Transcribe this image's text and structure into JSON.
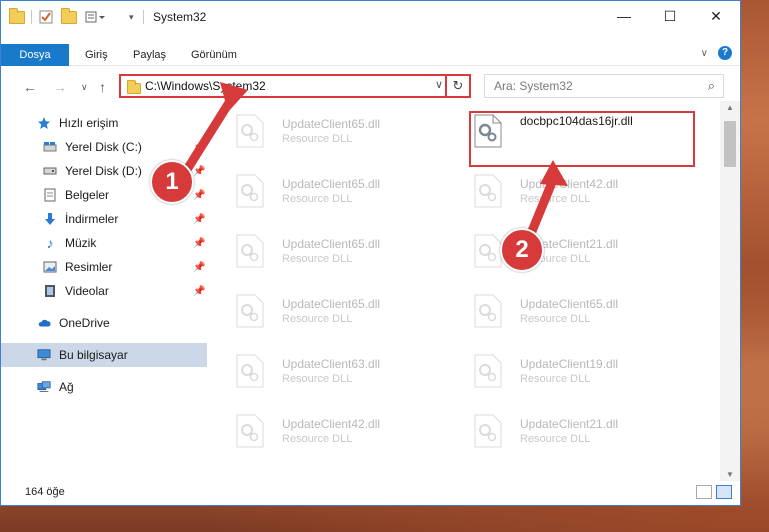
{
  "window": {
    "title": "System32"
  },
  "ribbon": {
    "tabs": [
      "Dosya",
      "Giriş",
      "Paylaş",
      "Görünüm"
    ]
  },
  "address": {
    "path": "C:\\Windows\\System32"
  },
  "search": {
    "placeholder": "Ara: System32"
  },
  "nav": {
    "quick_access": "Hızlı erişim",
    "items": [
      "Yerel Disk (C:)",
      "Yerel Disk (D:)",
      "Belgeler",
      "İndirmeler",
      "Müzik",
      "Resimler",
      "Videolar"
    ],
    "onedrive": "OneDrive",
    "this_pc": "Bu bilgisayar",
    "network": "Ağ"
  },
  "files": {
    "highlighted": {
      "name": "docbpc104das16jr.dll"
    },
    "left_column": [
      {
        "name": "UpdateClient65.dll",
        "desc": "Resource DLL"
      },
      {
        "name": "UpdateClient65.dll",
        "desc": "Resource DLL"
      },
      {
        "name": "UpdateClient65.dll",
        "desc": "Resource DLL"
      },
      {
        "name": "UpdateClient65.dll",
        "desc": "Resource DLL"
      },
      {
        "name": "UpdateClient63.dll",
        "desc": "Resource DLL"
      },
      {
        "name": "UpdateClient42.dll",
        "desc": "Resource DLL"
      }
    ],
    "right_column": [
      {
        "name": "UpdateClient42.dll",
        "desc": "Resource DLL"
      },
      {
        "name": "UpdateClient21.dll",
        "desc": "Resource DLL"
      },
      {
        "name": "UpdateClient65.dll",
        "desc": "Resource DLL"
      },
      {
        "name": "UpdateClient19.dll",
        "desc": "Resource DLL"
      },
      {
        "name": "UpdateClient21.dll",
        "desc": "Resource DLL"
      }
    ]
  },
  "status": {
    "count": "164 öğe"
  },
  "annotations": {
    "step1": "1",
    "step2": "2",
    "color": "#d63a3a"
  }
}
